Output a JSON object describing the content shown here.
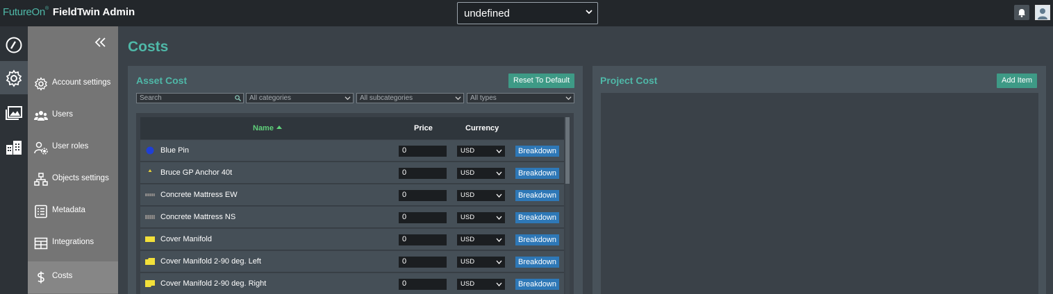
{
  "header": {
    "logo": "FutureOn",
    "logo_mark": "®",
    "app_title": "FieldTwin Admin",
    "project_select": "undefined"
  },
  "rail": {
    "items": [
      {
        "icon": "dashboard-icon"
      },
      {
        "icon": "settings-icon",
        "active": true
      },
      {
        "icon": "gallery-icon"
      },
      {
        "icon": "buildings-icon"
      }
    ]
  },
  "sidebar": {
    "items": [
      {
        "label": "Account settings",
        "icon": "gear-icon"
      },
      {
        "label": "Users",
        "icon": "users-icon"
      },
      {
        "label": "User roles",
        "icon": "user-roles-icon"
      },
      {
        "label": "Objects settings",
        "icon": "objects-icon"
      },
      {
        "label": "Metadata",
        "icon": "metadata-icon"
      },
      {
        "label": "Integrations",
        "icon": "integrations-icon"
      },
      {
        "label": "Costs",
        "icon": "dollar-icon",
        "active": true
      }
    ]
  },
  "page": {
    "title": "Costs"
  },
  "asset_cost": {
    "title": "Asset Cost",
    "reset_label": "Reset To Default",
    "search_placeholder": "Search",
    "filters": {
      "categories": "All categories",
      "subcategories": "All subcategories",
      "types": "All types"
    },
    "columns": {
      "name": "Name",
      "price": "Price",
      "currency": "Currency"
    },
    "breakdown_label": "Breakdown",
    "rows": [
      {
        "name": "Blue Pin",
        "price": "0",
        "currency": "USD",
        "icon": "blue-pin-icon",
        "color": "#1f3fd6"
      },
      {
        "name": "Bruce GP Anchor 40t",
        "price": "0",
        "currency": "USD",
        "icon": "anchor-icon",
        "color": "#e8d23a"
      },
      {
        "name": "Concrete Mattress EW",
        "price": "0",
        "currency": "USD",
        "icon": "mattress-icon",
        "color": "#8a8a8a"
      },
      {
        "name": "Concrete Mattress NS",
        "price": "0",
        "currency": "USD",
        "icon": "mattress-icon",
        "color": "#8a8a8a"
      },
      {
        "name": "Cover Manifold",
        "price": "0",
        "currency": "USD",
        "icon": "manifold-icon",
        "color": "#f2e03a"
      },
      {
        "name": "Cover Manifold 2-90 deg. Left",
        "price": "0",
        "currency": "USD",
        "icon": "manifold-icon",
        "color": "#f2e03a"
      },
      {
        "name": "Cover Manifold 2-90 deg. Right",
        "price": "0",
        "currency": "USD",
        "icon": "manifold-icon",
        "color": "#f2e03a"
      }
    ]
  },
  "project_cost": {
    "title": "Project Cost",
    "add_label": "Add Item"
  },
  "colors": {
    "accent": "#4fb8a8",
    "button_green": "#3e9a86",
    "breakdown_blue": "#2e78b7"
  }
}
